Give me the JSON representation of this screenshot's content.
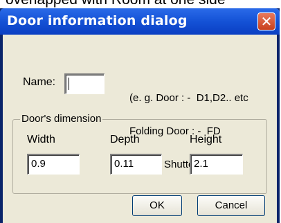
{
  "background_text": "overlapped with Room at one side",
  "window": {
    "title": "Door information dialog"
  },
  "name_field": {
    "label": "Name:",
    "value": ""
  },
  "hint": {
    "line1": "(e. g. Door : -  D1,D2.. etc",
    "line2": "Folding Door : -  FD",
    "line3": "Rolling Shutter : -  RS)"
  },
  "dimension": {
    "group_title": "Door's dimension",
    "width_label": "Width",
    "width_value": "0.9",
    "depth_label": "Depth",
    "depth_value": "0.11",
    "height_label": "Height",
    "height_value": "2.1"
  },
  "buttons": {
    "ok": "OK",
    "cancel": "Cancel"
  },
  "icons": {
    "close": "close-icon"
  },
  "colors": {
    "titlebar": "#1452d6",
    "close": "#c9401d",
    "client": "#ece9d8"
  }
}
